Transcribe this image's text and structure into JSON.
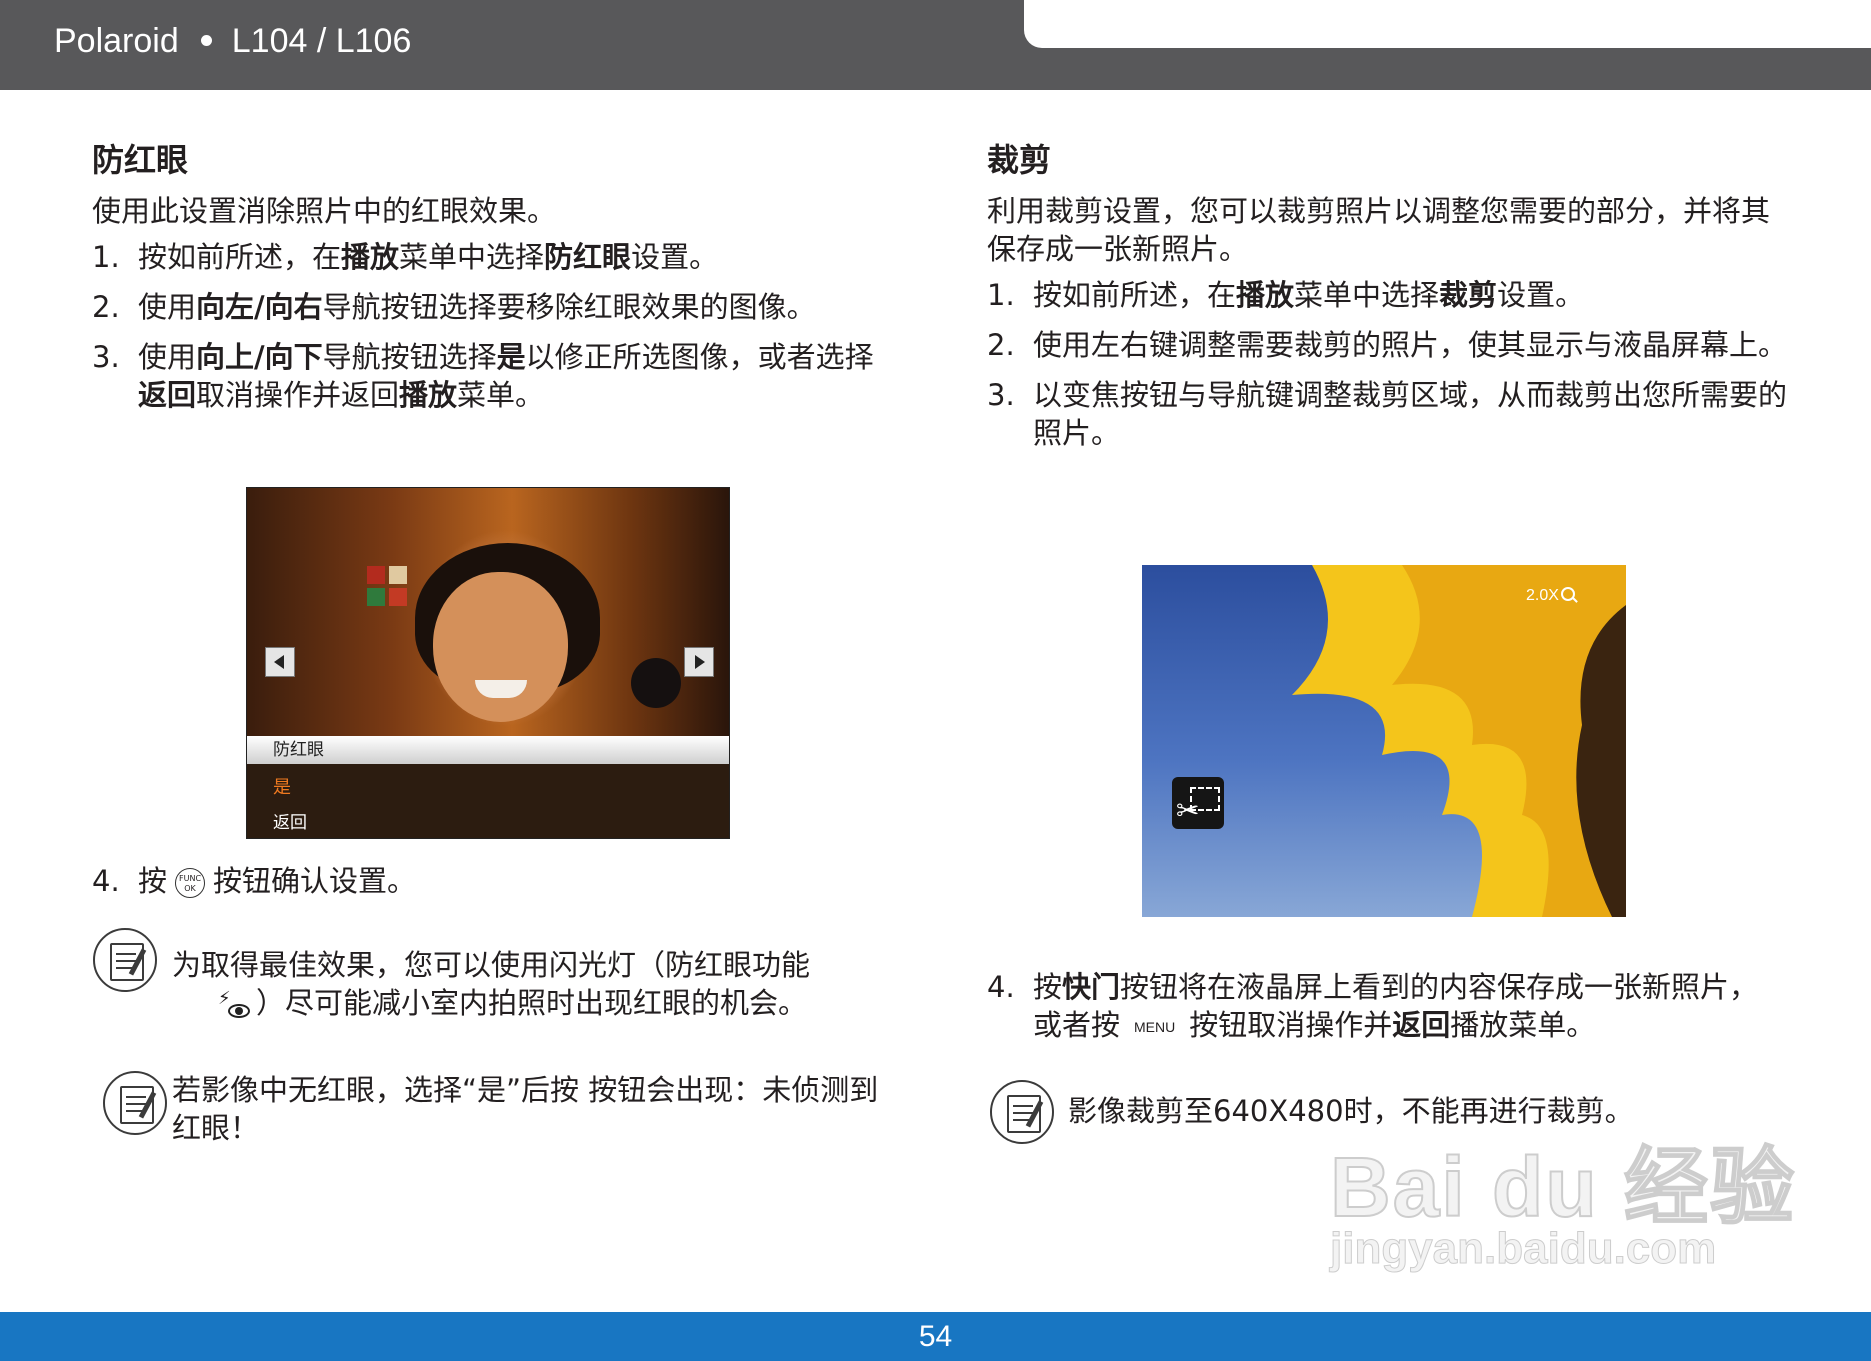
{
  "header": {
    "brand": "Polaroid",
    "model": "L104 / L106"
  },
  "footer": {
    "page_number": "54"
  },
  "left": {
    "title": "防红眼",
    "intro": "使用此设置消除照片中的红眼效果。",
    "steps": [
      {
        "num": "1.",
        "parts": [
          "按如前所述，在",
          "播放",
          "菜单中选择",
          "防红眼",
          "设置。"
        ]
      },
      {
        "num": "2.",
        "parts": [
          "使用",
          "向左/向右",
          "导航按钮选择要移除红眼效果的图像。"
        ]
      },
      {
        "num": "3.",
        "parts": [
          "使用",
          "向上/向下",
          "导航按钮选择",
          "是",
          "以修正所选图像，或者选择",
          "返回",
          "取消操作并返回",
          "播放",
          "菜单。"
        ]
      },
      {
        "num": "4.",
        "before": "按",
        "button_label": [
          "FUNC",
          "OK"
        ],
        "after": "按钮确认设置。"
      }
    ],
    "screen": {
      "menu_title": "防红眼",
      "option_yes": "是",
      "option_back": "返回",
      "yes_color": "#f07a20"
    },
    "note1": {
      "before": "为取得最佳效果，您可以使用闪光灯（防红眼功能",
      "after": "）尽可能减小室内拍照时出现红眼的机会。",
      "icon": "flash-redeye-icon"
    },
    "note2": {
      "text": "若影像中无红眼，选择“是”后按 按钮会出现：未侦测到红眼！"
    }
  },
  "right": {
    "title": "裁剪",
    "intro": "利用裁剪设置，您可以裁剪照片以调整您需要的部分，并将其保存成一张新照片。",
    "steps": [
      {
        "num": "1.",
        "parts": [
          "按如前所述，在",
          "播放",
          "菜单中选择",
          "裁剪",
          "设置。"
        ]
      },
      {
        "num": "2.",
        "parts": [
          "使用左右键调整需要裁剪的照片，使其显示与液晶屏幕上。"
        ]
      },
      {
        "num": "3.",
        "parts": [
          "以变焦按钮与导航键调整裁剪区域，从而裁剪出您所需要的照片。"
        ]
      },
      {
        "num": "4.",
        "parts": [
          "按",
          "快门",
          "按钮将在液晶屏上看到的内容保存成一张新照片，或者按",
          "MENU",
          "按钮取消操作并",
          "返回",
          "播放菜单。"
        ]
      }
    ],
    "screen": {
      "zoom_label": "2.0X"
    },
    "note1": {
      "text": "影像裁剪至640X480时，不能再进行裁剪。"
    }
  },
  "watermark": {
    "main": "Bai du 经验",
    "sub": "jingyan.baidu.com"
  },
  "colors": {
    "header": "#58585a",
    "footer": "#1876c2",
    "text": "#231f20"
  }
}
